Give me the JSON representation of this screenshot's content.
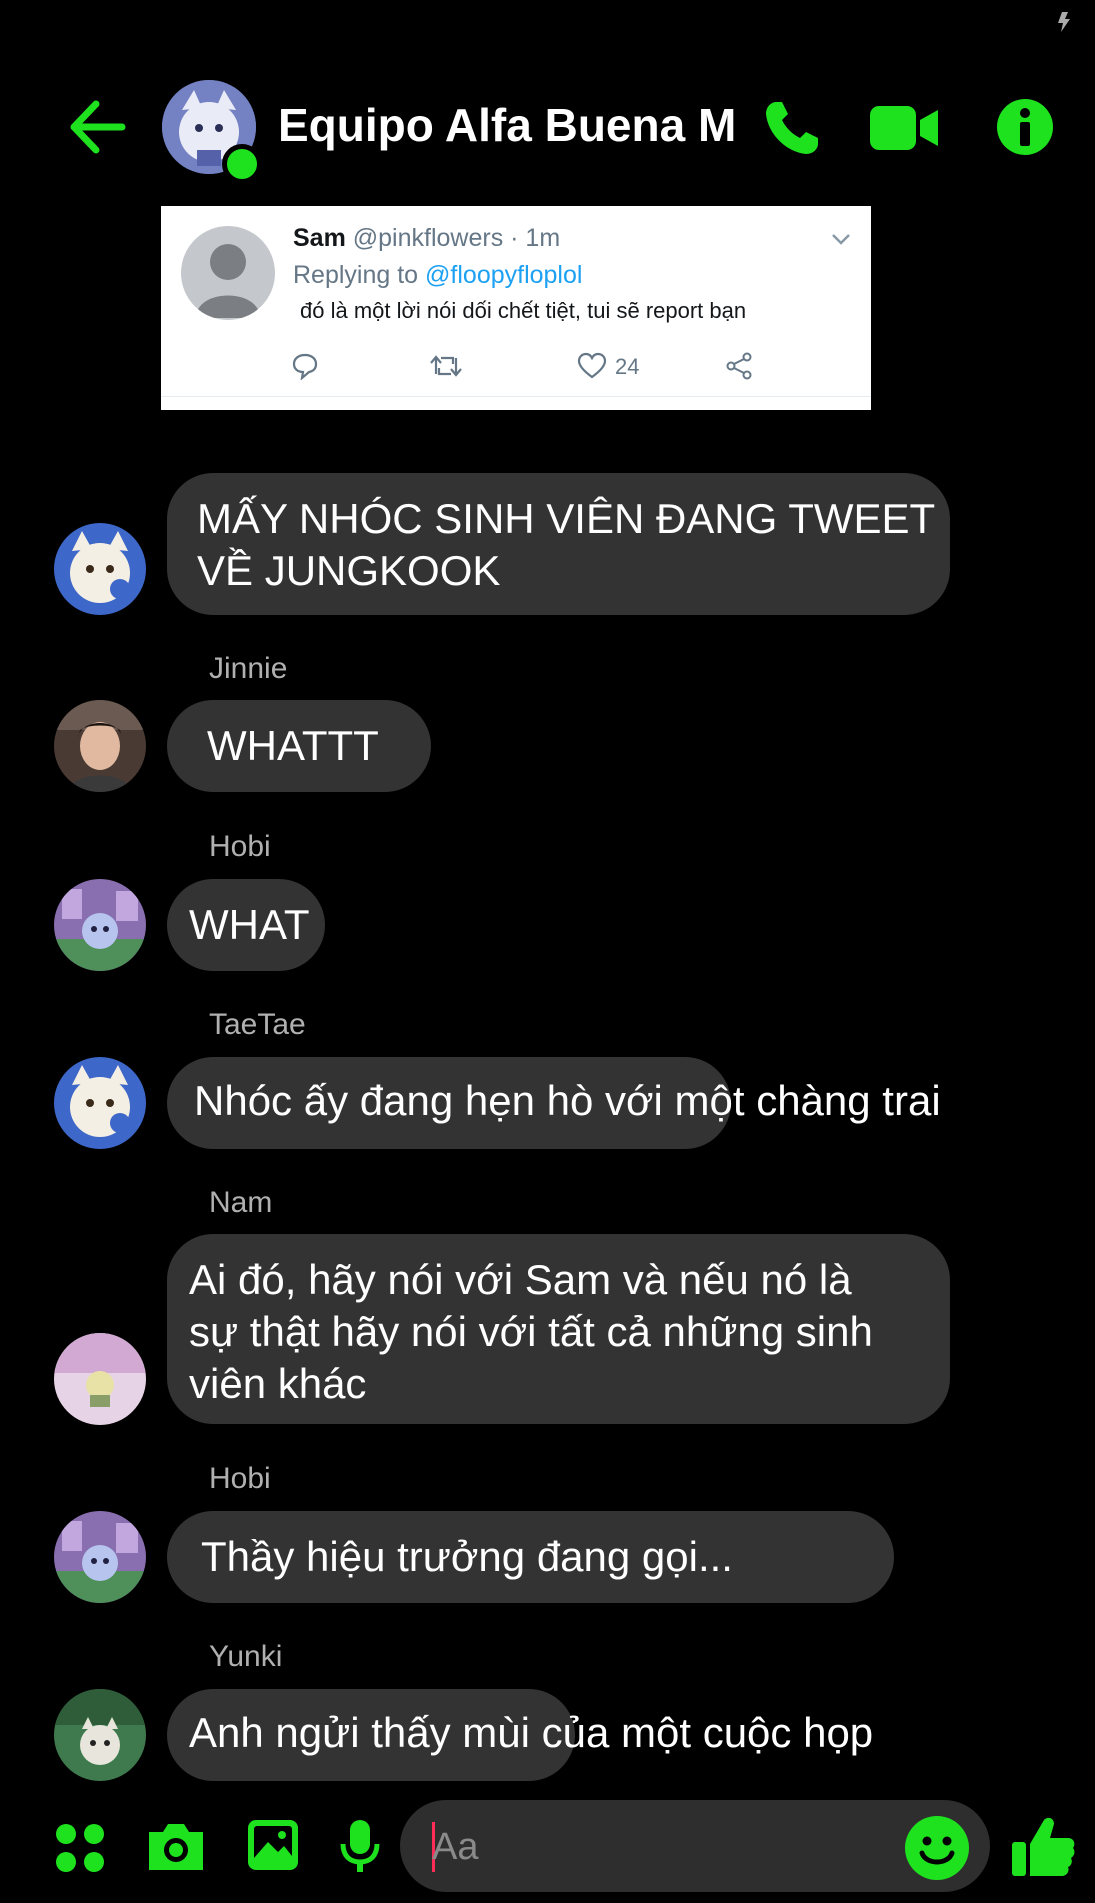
{
  "header": {
    "title": "Equipo Alfa Buena M...",
    "back_icon": "arrow-left-icon",
    "call_icon": "phone-icon",
    "video_icon": "video-camera-icon",
    "info_icon": "info-icon"
  },
  "tweet": {
    "display_name": "Sam",
    "handle_time": "@pinkflowers · 1m",
    "replying_prefix": "Replying to",
    "replying_handle": "@floopyfloplol",
    "text": "đó là một lời nói dối chết tiệt, tui sẽ report bạn",
    "likes": "24"
  },
  "messages": [
    {
      "sender": "",
      "text_line1": "MẤY NHÓC SINH VIÊN ĐANG TWEET",
      "text_line2": "VỀ JUNGKOOK"
    },
    {
      "sender": "Jinnie",
      "text": "WHATTT"
    },
    {
      "sender": "Hobi",
      "text": "WHAT"
    },
    {
      "sender": "TaeTae",
      "text": "Nhóc ấy đang hẹn hò với một chàng trai"
    },
    {
      "sender": "Nam",
      "text": "Ai đó, hãy nói với Sam và nếu nó là sự thật hãy nói với tất cả những sinh viên khác"
    },
    {
      "sender": "Hobi",
      "text": "Thầy hiệu trưởng đang gọi..."
    },
    {
      "sender": "Yunki",
      "text": "Anh ngửi thấy mùi của một cuộc họp"
    }
  ],
  "composer": {
    "placeholder": "Aa"
  },
  "colors": {
    "accent": "#1fe21f",
    "bubble": "#333333",
    "background": "#000000",
    "twitter_blue": "#1da1f2"
  }
}
